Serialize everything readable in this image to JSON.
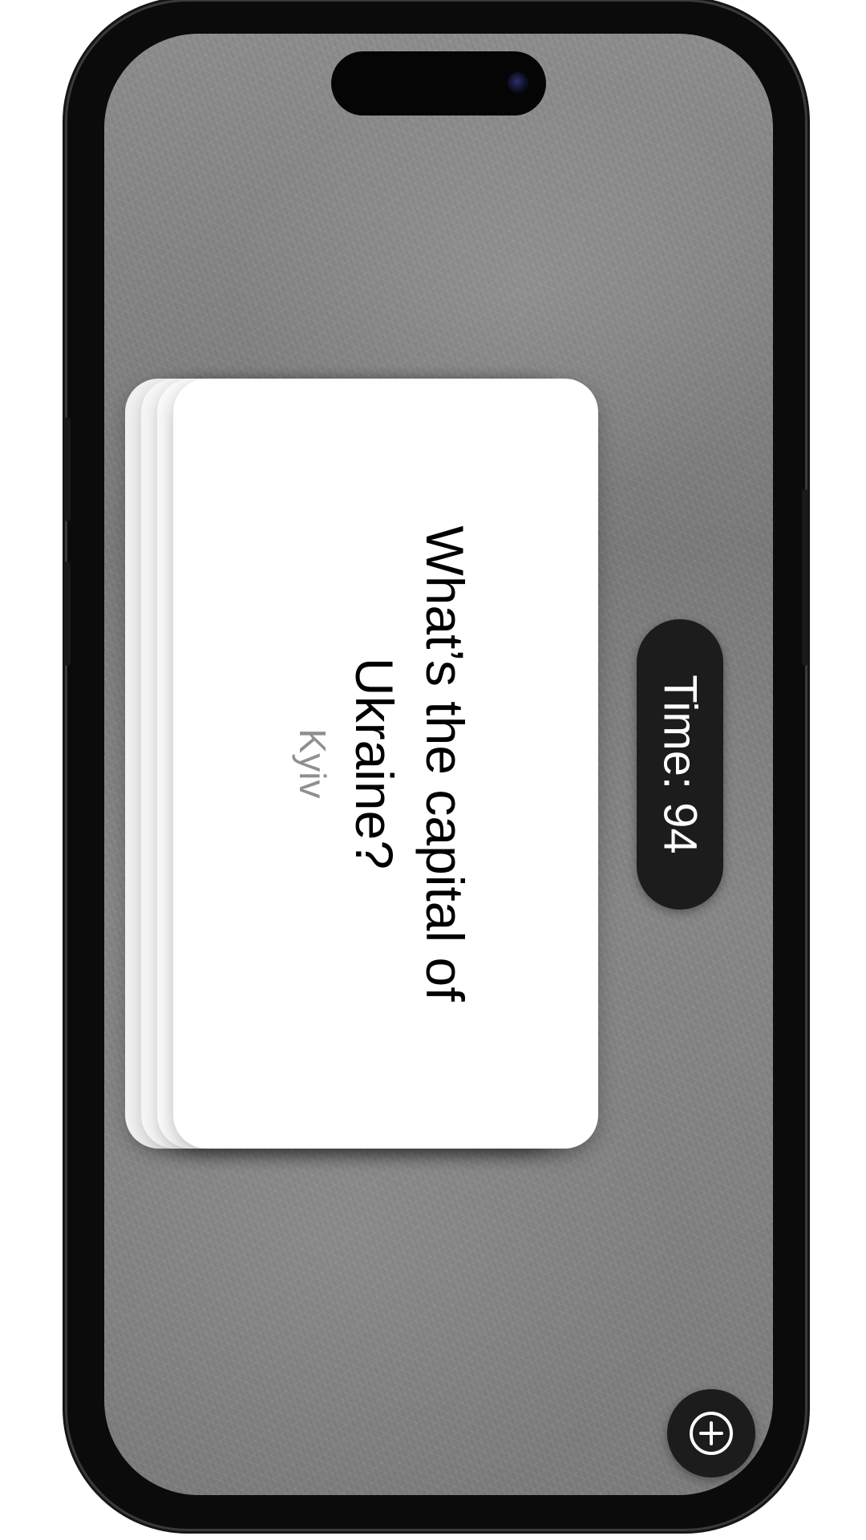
{
  "card": {
    "question": "What’s the capital of Ukraine?",
    "answer": "Kyiv"
  },
  "timer": {
    "text": "Time: 94"
  },
  "toolbar": {
    "add_icon": "plus-circle-icon"
  },
  "colors": {
    "pill_background": "#1c1c1c",
    "card_background": "#ffffff",
    "answer_text": "#8e8e93"
  }
}
